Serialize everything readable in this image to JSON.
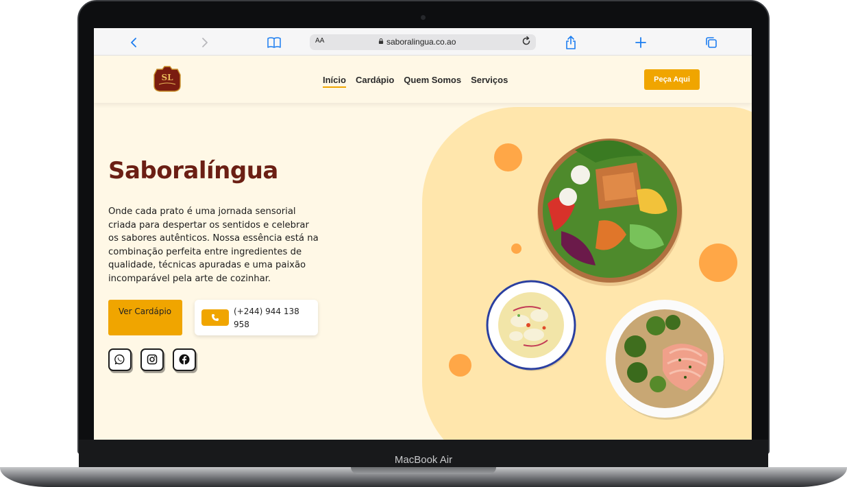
{
  "device": {
    "label": "MacBook Air"
  },
  "browser": {
    "reader_label": "AA",
    "url": "saboralingua.co.ao"
  },
  "site": {
    "logo_alt": "SL Saboralíngua",
    "nav": [
      {
        "label": "Início",
        "active": true
      },
      {
        "label": "Cardápio",
        "active": false
      },
      {
        "label": "Quem Somos",
        "active": false
      },
      {
        "label": "Serviços",
        "active": false
      }
    ],
    "order_button": "Peça Aqui"
  },
  "hero": {
    "title": "Saboralíngua",
    "description": "Onde cada prato é uma jornada sensorial criada para despertar os sentidos e celebrar os sabores autênticos. Nossa essência está na combinação perfeita entre ingredientes de qualidade, técnicas apuradas e uma paixão incomparável pela arte de cozinhar.",
    "menu_button": "Ver Cardápio",
    "phone": "(+244) 944 138 958",
    "social": [
      "whatsapp-icon",
      "instagram-icon",
      "facebook-icon"
    ]
  },
  "colors": {
    "accent": "#f0a500",
    "title": "#6b1f14",
    "background": "#fff8e6",
    "blob": "#ffe6ac",
    "dots": "#ffa747"
  }
}
